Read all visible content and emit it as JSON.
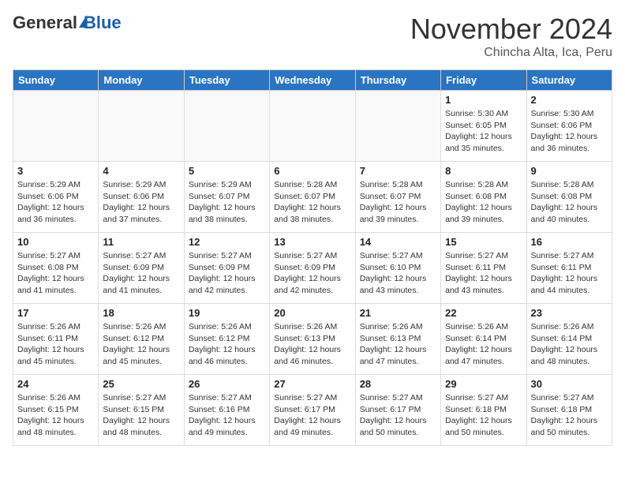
{
  "header": {
    "logo_general": "General",
    "logo_blue": "Blue",
    "month_year": "November 2024",
    "location": "Chincha Alta, Ica, Peru"
  },
  "weekdays": [
    "Sunday",
    "Monday",
    "Tuesday",
    "Wednesday",
    "Thursday",
    "Friday",
    "Saturday"
  ],
  "weeks": [
    [
      {
        "day": "",
        "info": ""
      },
      {
        "day": "",
        "info": ""
      },
      {
        "day": "",
        "info": ""
      },
      {
        "day": "",
        "info": ""
      },
      {
        "day": "",
        "info": ""
      },
      {
        "day": "1",
        "info": "Sunrise: 5:30 AM\nSunset: 6:05 PM\nDaylight: 12 hours\nand 35 minutes."
      },
      {
        "day": "2",
        "info": "Sunrise: 5:30 AM\nSunset: 6:06 PM\nDaylight: 12 hours\nand 36 minutes."
      }
    ],
    [
      {
        "day": "3",
        "info": "Sunrise: 5:29 AM\nSunset: 6:06 PM\nDaylight: 12 hours\nand 36 minutes."
      },
      {
        "day": "4",
        "info": "Sunrise: 5:29 AM\nSunset: 6:06 PM\nDaylight: 12 hours\nand 37 minutes."
      },
      {
        "day": "5",
        "info": "Sunrise: 5:29 AM\nSunset: 6:07 PM\nDaylight: 12 hours\nand 38 minutes."
      },
      {
        "day": "6",
        "info": "Sunrise: 5:28 AM\nSunset: 6:07 PM\nDaylight: 12 hours\nand 38 minutes."
      },
      {
        "day": "7",
        "info": "Sunrise: 5:28 AM\nSunset: 6:07 PM\nDaylight: 12 hours\nand 39 minutes."
      },
      {
        "day": "8",
        "info": "Sunrise: 5:28 AM\nSunset: 6:08 PM\nDaylight: 12 hours\nand 39 minutes."
      },
      {
        "day": "9",
        "info": "Sunrise: 5:28 AM\nSunset: 6:08 PM\nDaylight: 12 hours\nand 40 minutes."
      }
    ],
    [
      {
        "day": "10",
        "info": "Sunrise: 5:27 AM\nSunset: 6:08 PM\nDaylight: 12 hours\nand 41 minutes."
      },
      {
        "day": "11",
        "info": "Sunrise: 5:27 AM\nSunset: 6:09 PM\nDaylight: 12 hours\nand 41 minutes."
      },
      {
        "day": "12",
        "info": "Sunrise: 5:27 AM\nSunset: 6:09 PM\nDaylight: 12 hours\nand 42 minutes."
      },
      {
        "day": "13",
        "info": "Sunrise: 5:27 AM\nSunset: 6:09 PM\nDaylight: 12 hours\nand 42 minutes."
      },
      {
        "day": "14",
        "info": "Sunrise: 5:27 AM\nSunset: 6:10 PM\nDaylight: 12 hours\nand 43 minutes."
      },
      {
        "day": "15",
        "info": "Sunrise: 5:27 AM\nSunset: 6:11 PM\nDaylight: 12 hours\nand 43 minutes."
      },
      {
        "day": "16",
        "info": "Sunrise: 5:27 AM\nSunset: 6:11 PM\nDaylight: 12 hours\nand 44 minutes."
      }
    ],
    [
      {
        "day": "17",
        "info": "Sunrise: 5:26 AM\nSunset: 6:11 PM\nDaylight: 12 hours\nand 45 minutes."
      },
      {
        "day": "18",
        "info": "Sunrise: 5:26 AM\nSunset: 6:12 PM\nDaylight: 12 hours\nand 45 minutes."
      },
      {
        "day": "19",
        "info": "Sunrise: 5:26 AM\nSunset: 6:12 PM\nDaylight: 12 hours\nand 46 minutes."
      },
      {
        "day": "20",
        "info": "Sunrise: 5:26 AM\nSunset: 6:13 PM\nDaylight: 12 hours\nand 46 minutes."
      },
      {
        "day": "21",
        "info": "Sunrise: 5:26 AM\nSunset: 6:13 PM\nDaylight: 12 hours\nand 47 minutes."
      },
      {
        "day": "22",
        "info": "Sunrise: 5:26 AM\nSunset: 6:14 PM\nDaylight: 12 hours\nand 47 minutes."
      },
      {
        "day": "23",
        "info": "Sunrise: 5:26 AM\nSunset: 6:14 PM\nDaylight: 12 hours\nand 48 minutes."
      }
    ],
    [
      {
        "day": "24",
        "info": "Sunrise: 5:26 AM\nSunset: 6:15 PM\nDaylight: 12 hours\nand 48 minutes."
      },
      {
        "day": "25",
        "info": "Sunrise: 5:27 AM\nSunset: 6:15 PM\nDaylight: 12 hours\nand 48 minutes."
      },
      {
        "day": "26",
        "info": "Sunrise: 5:27 AM\nSunset: 6:16 PM\nDaylight: 12 hours\nand 49 minutes."
      },
      {
        "day": "27",
        "info": "Sunrise: 5:27 AM\nSunset: 6:17 PM\nDaylight: 12 hours\nand 49 minutes."
      },
      {
        "day": "28",
        "info": "Sunrise: 5:27 AM\nSunset: 6:17 PM\nDaylight: 12 hours\nand 50 minutes."
      },
      {
        "day": "29",
        "info": "Sunrise: 5:27 AM\nSunset: 6:18 PM\nDaylight: 12 hours\nand 50 minutes."
      },
      {
        "day": "30",
        "info": "Sunrise: 5:27 AM\nSunset: 6:18 PM\nDaylight: 12 hours\nand 50 minutes."
      }
    ]
  ]
}
